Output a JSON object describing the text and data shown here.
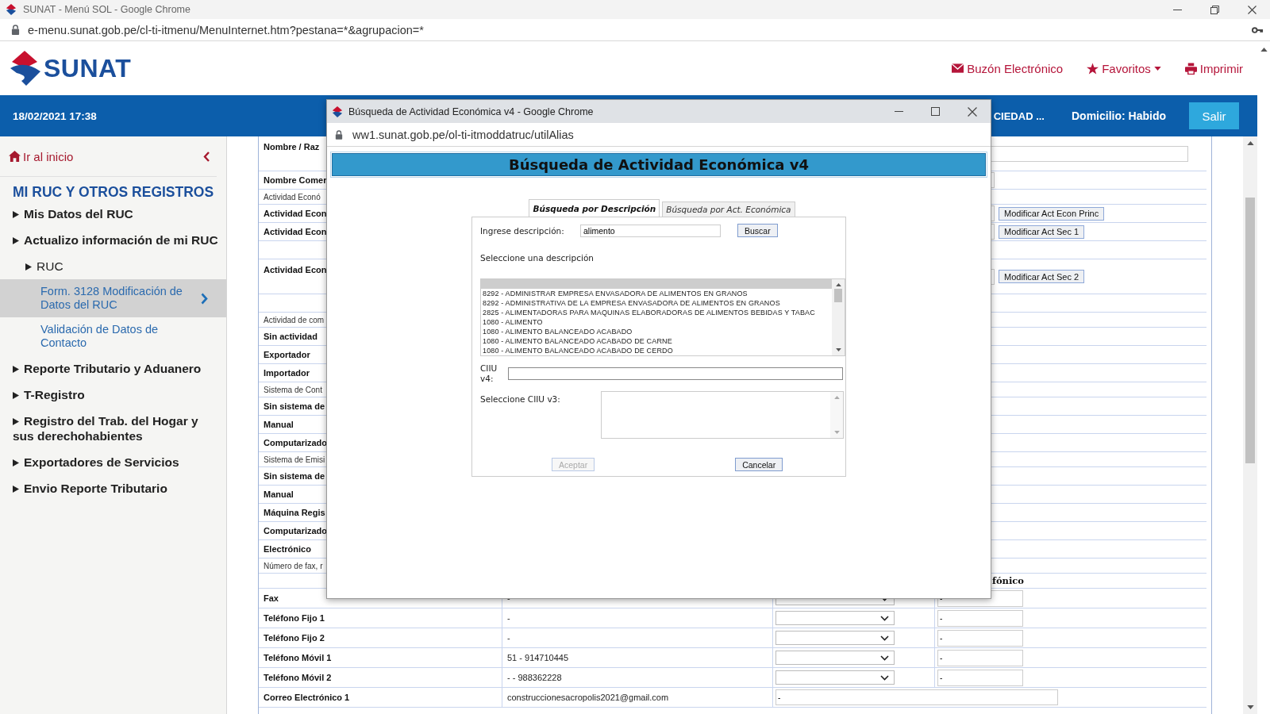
{
  "browser": {
    "title": "SUNAT - Menú SOL - Google Chrome",
    "url": "e-menu.sunat.gob.pe/cl-ti-itmenu/MenuInternet.htm?pestana=*&agrupacion=*"
  },
  "header": {
    "logo_text": "SUNAT",
    "links": [
      {
        "label": "Buzón Electrónico",
        "kind": "mail",
        "dropdown": false
      },
      {
        "label": "Favoritos",
        "kind": "favorites",
        "dropdown": true
      },
      {
        "label": "Imprimir",
        "kind": "print",
        "dropdown": false
      }
    ]
  },
  "top_bar": {
    "datetime": "18/02/2021 17:38",
    "company": "CIEDAD ...",
    "address_status": "Domicilio: Habido",
    "logout": "Salir"
  },
  "sidebar": {
    "home": "Ir al inicio",
    "section": "MI RUC Y OTROS REGISTROS",
    "items": [
      {
        "label": "Mis Datos del RUC",
        "selected": false
      },
      {
        "label": "Actualizo información de mi RUC",
        "selected": false,
        "children": [
          {
            "label": "RUC",
            "selected": false,
            "children": [
              {
                "label": "Form. 3128 Modificación de Datos del RUC",
                "selected": true
              },
              {
                "label": "Validación de Datos de Contacto",
                "selected": false
              }
            ]
          }
        ]
      },
      {
        "label": "Reporte Tributario y Aduanero",
        "selected": false
      },
      {
        "label": "T-Registro",
        "selected": false
      },
      {
        "label": "Registro del Trab. del Hogar y sus derechohabientes",
        "selected": false
      },
      {
        "label": "Exportadores de Servicios",
        "selected": false
      },
      {
        "label": "Envio Reporte Tributario",
        "selected": false
      }
    ]
  },
  "form": {
    "rows": [
      {
        "label": "Nombre / Raz",
        "kind": "tall-field",
        "input": true,
        "wide": true
      },
      {
        "label": "Nombre Comer",
        "kind": "field",
        "input": true,
        "wide": false
      },
      {
        "label": "Actividad Econó",
        "kind": "section"
      },
      {
        "label": "Actividad Econ",
        "kind": "field",
        "input": true,
        "wide": false,
        "action": "Modificar Act Econ Princ"
      },
      {
        "label": "Actividad Econ",
        "kind": "field",
        "input": true,
        "wide": false,
        "action": "Modificar Act Sec 1"
      },
      {
        "kind": "blank"
      },
      {
        "label": "Actividad Econ",
        "kind": "tall-field",
        "input": true,
        "wide": false,
        "action": "Modificar Act Sec 2"
      },
      {
        "kind": "blank"
      },
      {
        "label": "Actividad de com",
        "kind": "section"
      },
      {
        "label": "Sin actividad",
        "kind": "field"
      },
      {
        "label": "Exportador",
        "kind": "field"
      },
      {
        "label": "Importador",
        "kind": "field"
      },
      {
        "label": "Sistema de Cont",
        "kind": "section"
      },
      {
        "label": "Sin sistema de",
        "kind": "field"
      },
      {
        "label": "Manual",
        "kind": "field"
      },
      {
        "label": "Computarizado",
        "kind": "field"
      },
      {
        "label": "Sistema de Emisi",
        "kind": "section"
      },
      {
        "label": "Sin sistema de",
        "kind": "field"
      },
      {
        "label": "Manual",
        "kind": "field"
      },
      {
        "label": "Máquina Regis",
        "kind": "field"
      },
      {
        "label": "Computarizado",
        "kind": "field"
      },
      {
        "label": "Electrónico",
        "kind": "field"
      },
      {
        "label": "Número de fax, r",
        "kind": "section"
      }
    ]
  },
  "contact_table": {
    "column_4_header": "fónico",
    "rows": [
      {
        "label": "Fax",
        "value": "-",
        "input": "-",
        "kind": "phone"
      },
      {
        "label": "Teléfono Fijo 1",
        "value": "-",
        "input": "-",
        "kind": "phone"
      },
      {
        "label": "Teléfono Fijo 2",
        "value": "-",
        "input": "-",
        "kind": "phone"
      },
      {
        "label": "Teléfono Móvil 1",
        "value": "51 - 914710445",
        "input": "-",
        "kind": "phone"
      },
      {
        "label": "Teléfono Móvil 2",
        "value": "- - 988362228",
        "input": "-",
        "kind": "phone"
      },
      {
        "label": "Correo Electrónico 1",
        "value": "construccionesacropolis2021@gmail.com",
        "input": "-",
        "kind": "email"
      }
    ]
  },
  "dialog": {
    "window_title": "Búsqueda de Actividad Económica v4 - Google Chrome",
    "url": "ww1.sunat.gob.pe/ol-ti-itmoddatruc/utilAlias",
    "heading": "Búsqueda de Actividad Económica v4",
    "tabs": [
      {
        "label": "Búsqueda por Descripción",
        "selected": true
      },
      {
        "label": "Búsqueda por Act. Económica",
        "selected": false
      }
    ],
    "description_label": "Ingrese descripción:",
    "description_value": "alimento",
    "search_button": "Buscar",
    "list_label": "Seleccione una descripción",
    "list": {
      "blank_selected": true,
      "options": [
        "8292 - ADMINISTRAR EMPRESA ENVASADORA DE ALIMENTOS EN GRANOS",
        "8292 - ADMINISTRATIVA DE LA EMPRESA ENVASADORA DE ALIMENTOS EN GRANOS",
        "2825 - ALIMENTADORAS PARA MAQUINAS ELABORADORAS DE ALIMENTOS BEBIDAS Y TABAC",
        "1080 - ALIMENTO",
        "1080 - ALIMENTO BALANCEADO ACABADO",
        "1080 - ALIMENTO BALANCEADO ACABADO DE CARNE",
        "1080 - ALIMENTO BALANCEADO ACABADO DE CERDO"
      ]
    },
    "ciiu4_label": "CIIU v4:",
    "ciiu3_label": "Seleccione CIIU v3:",
    "buttons": [
      {
        "label": "Aceptar",
        "disabled": true
      },
      {
        "label": "Cancelar",
        "disabled": false
      }
    ]
  }
}
